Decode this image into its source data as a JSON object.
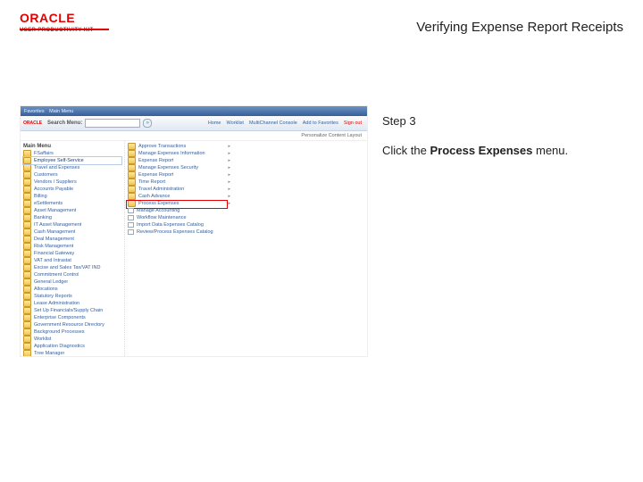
{
  "header": {
    "logo_main": "ORACLE",
    "logo_sub": "USER PRODUCTIVITY KIT",
    "title": "Verifying Expense Report Receipts"
  },
  "instruction": {
    "step_label": "Step 3",
    "line_before": "Click the ",
    "bold": "Process Expenses",
    "line_after": " menu."
  },
  "app": {
    "breadcrumb": [
      "Favorites",
      "Main Menu"
    ],
    "search_label": "Search Menu:",
    "go_glyph": "»",
    "nav": {
      "home": "Home",
      "worklist": "Worklist",
      "mc": "MultiChannel Console",
      "addfav": "Add to Favorites",
      "signout": "Sign out"
    },
    "subbar": "Personalize Content   Layout",
    "left_menu_title": "Main Menu",
    "left_menu": [
      "FSaffairs",
      "Employee Self-Service",
      "Travel and Expenses",
      "Customers",
      "Vendors / Suppliers",
      "Accounts Payable",
      "Billing",
      "eSettlements",
      "Asset Management",
      "Banking",
      "IT Asset Management",
      "Cash Management",
      "Deal Management",
      "Risk Management",
      "Financial Gateway",
      "VAT and Intrastat",
      "Excise and Sales Tax/VAT IND",
      "Commitment Control",
      "General Ledger",
      "Allocations",
      "Statutory Reports",
      "Lease Administration",
      "Set Up Financials/Supply Chain",
      "Enterprise Components",
      "Government Resource Directory",
      "Background Processes",
      "Worklist",
      "Application Diagnostics",
      "Tree Manager"
    ],
    "left_selected_index": 1,
    "right_menu": [
      {
        "t": "folder",
        "l": "Approve Transactions"
      },
      {
        "t": "folder",
        "l": "Manage Expenses Information"
      },
      {
        "t": "folder",
        "l": "Expense Report"
      },
      {
        "t": "folder",
        "l": "Manage Expenses Security"
      },
      {
        "t": "folder",
        "l": "Expense Report"
      },
      {
        "t": "folder",
        "l": "Time Report"
      },
      {
        "t": "folder",
        "l": "Travel Administration"
      },
      {
        "t": "folder",
        "l": "Cash Advance"
      },
      {
        "t": "folder",
        "l": "Process Expenses"
      },
      {
        "t": "txn",
        "l": "Manage Accounting"
      },
      {
        "t": "txn",
        "l": "Workflow Maintenance"
      },
      {
        "t": "txn",
        "l": "Import Data Expenses Catalog"
      },
      {
        "t": "txn",
        "l": "Review/Process Expenses Catalog"
      }
    ],
    "highlight_index": 8
  }
}
